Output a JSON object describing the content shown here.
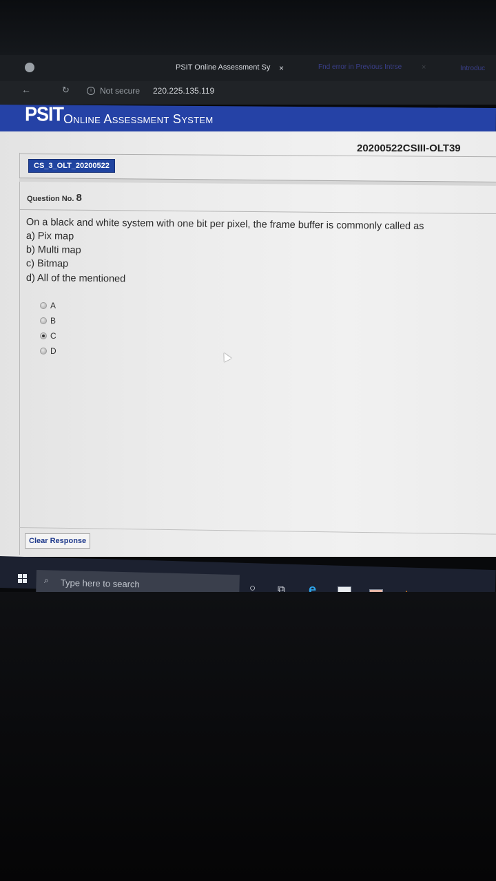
{
  "browser": {
    "active_tab_title": "PSIT Online Assessment Sy",
    "active_tab_close": "×",
    "second_tab_title": "Fnd error in Previous Intrse",
    "second_tab_close": "×",
    "third_tab_title": "Introduc",
    "security_text": "Not secure",
    "url": "220.225.135.119"
  },
  "header": {
    "brand": "PSIT",
    "subtitle": "Online Assessment System"
  },
  "test": {
    "code": "20200522CSIII-OLT39",
    "course_tab": "CS_3_OLT_20200522"
  },
  "question": {
    "label": "Question No.",
    "number": "8",
    "text": "On a black and white system with one bit per pixel, the frame buffer is commonly called as",
    "options_text": [
      "a) Pix map",
      "b) Multi map",
      "c) Bitmap",
      "d) All of the mentioned"
    ],
    "choices": [
      {
        "label": "A",
        "selected": false
      },
      {
        "label": "B",
        "selected": false
      },
      {
        "label": "C",
        "selected": true
      },
      {
        "label": "D",
        "selected": false
      }
    ]
  },
  "actions": {
    "clear_response": "Clear Response"
  },
  "taskbar": {
    "search_placeholder": "Type here to search",
    "icons": [
      "windows-start-icon",
      "cortana-icon",
      "task-view-icon",
      "edge-icon",
      "excel-icon",
      "office-icon",
      "vlc-icon",
      "file-explorer-icon",
      "photos-icon"
    ]
  }
}
